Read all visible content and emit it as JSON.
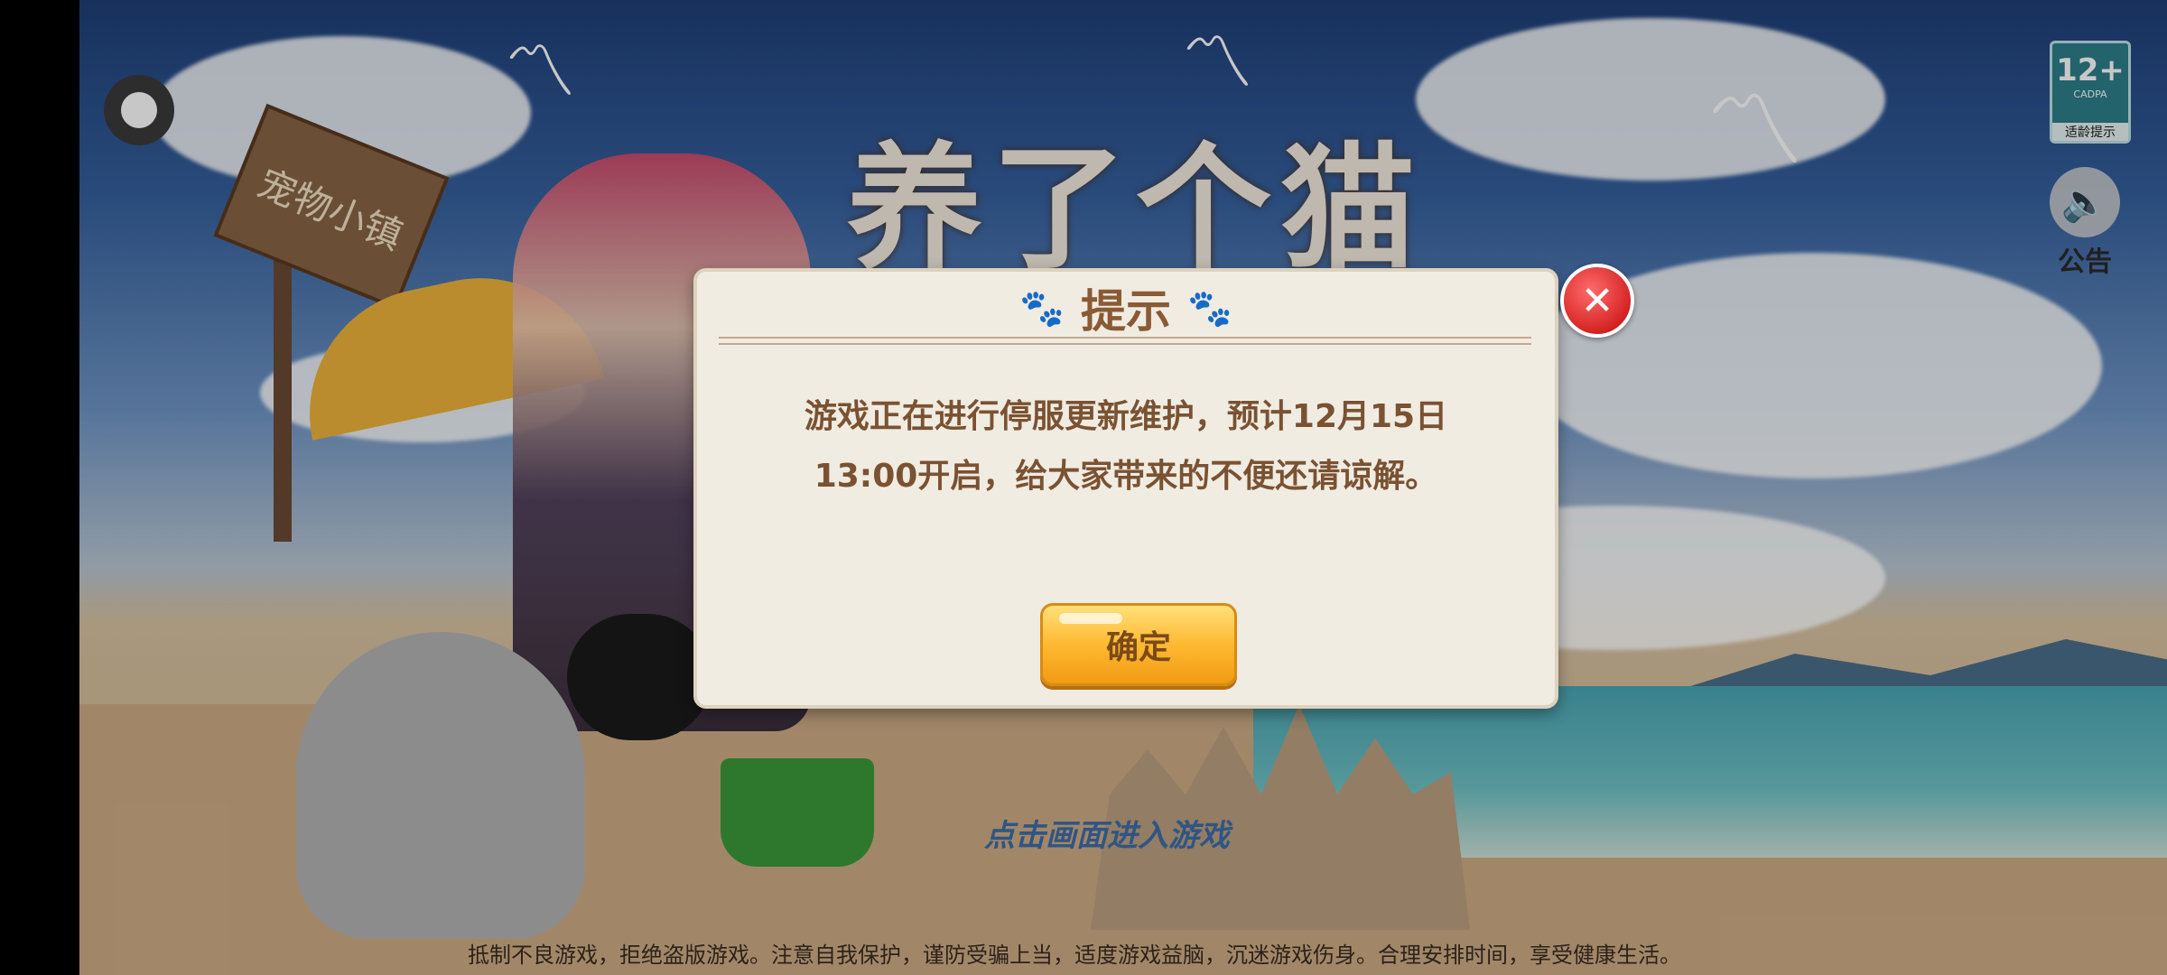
{
  "background": {
    "game_logo_text": "养了个猫",
    "sign_text": "宠物小镇",
    "tap_to_enter": "点击画面进入游戏",
    "health_notice": "抵制不良游戏，拒绝盗版游戏。注意自我保护，谨防受骗上当，适度游戏益脑，沉迷游戏伤身。合理安排时间，享受健康生活。"
  },
  "top_right": {
    "age_rating": "12+",
    "age_org": "CADPA",
    "age_tip": "适龄提示",
    "sound_icon": "speaker-icon",
    "notice_label": "公告"
  },
  "dialog": {
    "title": "提示",
    "title_icon": "paw-icon",
    "message": "游戏正在进行停服更新维护，预计12月15日13:00开启，给大家带来的不便还请谅解。",
    "confirm_label": "确定",
    "close_icon": "close-icon"
  },
  "colors": {
    "dialog_bg": "#f0ece2",
    "title_brown": "#8a5a34",
    "button_orange": "#ffb931",
    "close_red": "#d52424"
  }
}
